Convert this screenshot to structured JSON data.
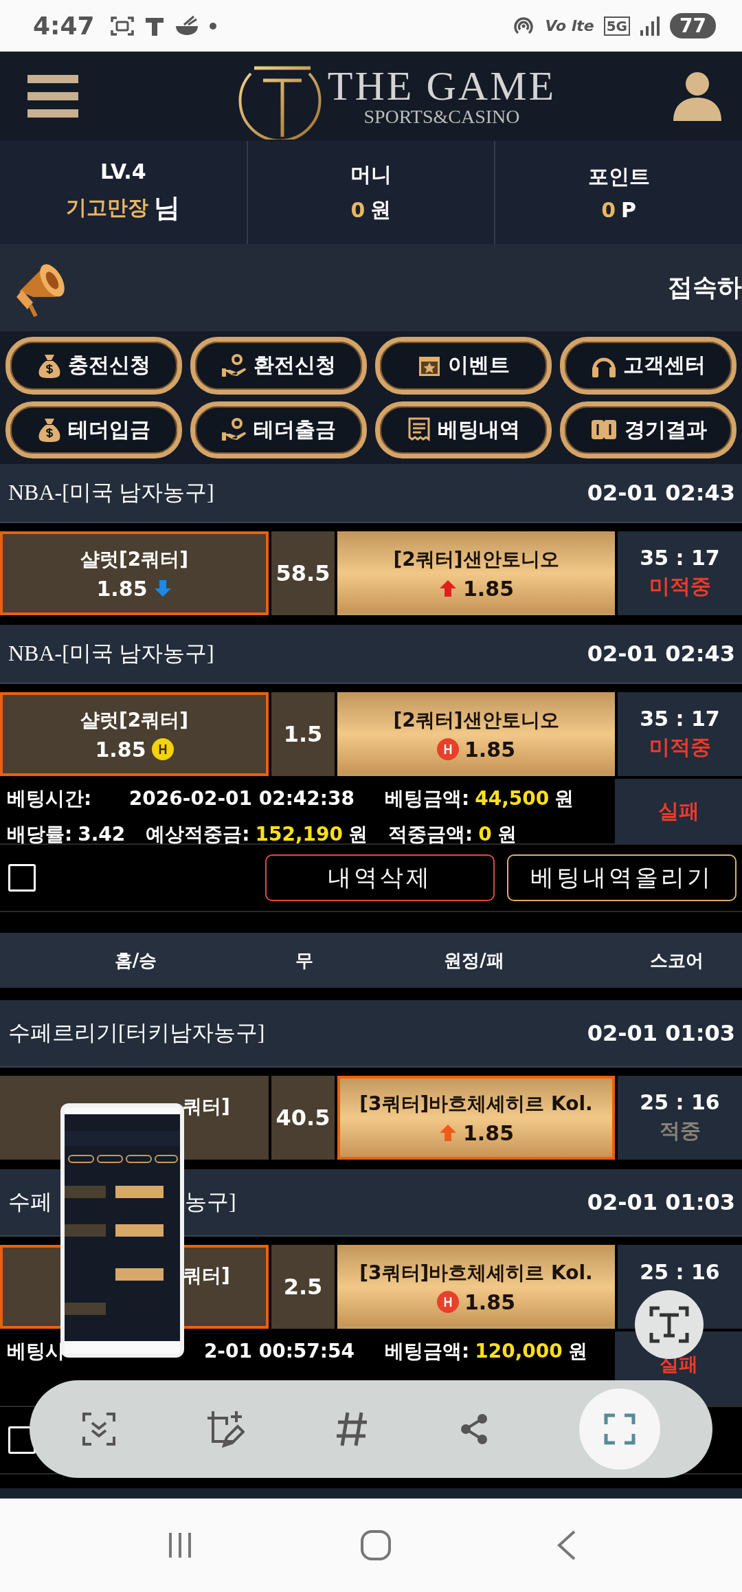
{
  "status_bar": {
    "time": "4:47",
    "volte": "Vo lte",
    "network": "5G",
    "battery": "77"
  },
  "header": {
    "brand": "THE GAME",
    "tagline": "SPORTS&CASINO"
  },
  "user_stats": [
    {
      "label": "LV.4",
      "value": "기고만장",
      "unit": "님",
      "kind": "user"
    },
    {
      "label": "머니",
      "value": "0",
      "unit": "원",
      "kind": "balance"
    },
    {
      "label": "포인트",
      "value": "0",
      "unit": "P",
      "kind": "balance"
    }
  ],
  "notice": {
    "text": "접속하"
  },
  "menu_buttons": [
    {
      "label": "충전신청",
      "kind": "moneybag"
    },
    {
      "label": "환전신청",
      "kind": "handcoin"
    },
    {
      "label": "이벤트",
      "kind": "calendar"
    },
    {
      "label": "고객센터",
      "kind": "headset"
    },
    {
      "label": "테더입금",
      "kind": "moneybag"
    },
    {
      "label": "테더출금",
      "kind": "handcoin"
    },
    {
      "label": "베팅내역",
      "kind": "receipt"
    },
    {
      "label": "경기결과",
      "kind": "cards"
    }
  ],
  "bet_slips": [
    {
      "matches": [
        {
          "league": "NBA-[미국 남자농구]",
          "time": "02-01 02:43",
          "home": {
            "name": "샬럿[2쿼터]",
            "odds": "1.85",
            "marker": {
              "kind": "down",
              "color": "#1e88e5"
            },
            "selected": true
          },
          "line": "58.5",
          "away": {
            "name": "[2쿼터]샌안토니오",
            "odds": "1.85",
            "marker": {
              "kind": "up",
              "color": "#e0201a"
            },
            "selected": false
          },
          "score": "35 : 17",
          "result": {
            "text": "미적중",
            "kind": "miss"
          }
        },
        {
          "league": "NBA-[미국 남자농구]",
          "time": "02-01 02:43",
          "home": {
            "name": "샬럿[2쿼터]",
            "odds": "1.85",
            "marker": {
              "kind": "handicap",
              "color": "#f5d20a"
            },
            "selected": true
          },
          "line": "1.5",
          "away": {
            "name": "[2쿼터]샌안토니오",
            "odds": "1.85",
            "marker": {
              "kind": "handicap",
              "color": "#e8402a"
            },
            "selected": false
          },
          "score": "35 : 17",
          "result": {
            "text": "미적중",
            "kind": "miss"
          }
        }
      ],
      "info": [
        [
          {
            "label": "베팅시간:",
            "value": "2026-02-01 02:42:38",
            "highlight": false
          },
          {
            "label": "베팅금액:",
            "value": "44,500",
            "unit": "원",
            "highlight": true
          }
        ],
        [
          {
            "label": "배당률:",
            "value": "3.42",
            "highlight": false
          },
          {
            "label": "예상적중금:",
            "value": "152,190",
            "unit": "원",
            "highlight": true
          },
          {
            "label": "적중금액:",
            "value": "0",
            "unit": "원",
            "highlight": true
          }
        ]
      ],
      "status": "실패",
      "checkbox": {
        "checked": false
      },
      "buttons": [
        {
          "label": "내역삭제",
          "kind": "delete"
        },
        {
          "label": "베팅내역올리기",
          "kind": "upload"
        }
      ]
    },
    {
      "columns": [
        "홈/승",
        "무",
        "원정/패",
        "스코어"
      ],
      "matches": [
        {
          "league": "수페르리기[터키남자농구]",
          "time": "02-01 01:03",
          "home": {
            "name": "쿼터]",
            "partial": true,
            "selected": false
          },
          "line": "40.5",
          "away": {
            "name": "[3쿼터]바흐체셰히르 Kol.",
            "odds": "1.85",
            "marker": {
              "kind": "up",
              "color": "#f05a1a"
            },
            "selected": true
          },
          "score": "25 : 16",
          "result": {
            "text": "적중",
            "kind": "hit"
          }
        },
        {
          "league": "수페",
          "league_tail": "농구]",
          "time": "02-01 01:03",
          "home": {
            "name": "쿼터]",
            "partial": true,
            "selected": true
          },
          "line": "2.5",
          "away": {
            "name": "[3쿼터]바흐체셰히르 Kol.",
            "odds": "1.85",
            "marker": {
              "kind": "handicap",
              "color": "#e8402a"
            },
            "selected": false
          },
          "score": "25 : 16"
        }
      ],
      "info": [
        [
          {
            "label": "베팅시",
            "value": "2-01 00:57:54",
            "highlight": false
          },
          {
            "label": "베팅금액:",
            "value": "120,000",
            "unit": "원",
            "highlight": true
          }
        ]
      ],
      "status": "실패",
      "checkbox": {
        "checked": false
      }
    }
  ]
}
